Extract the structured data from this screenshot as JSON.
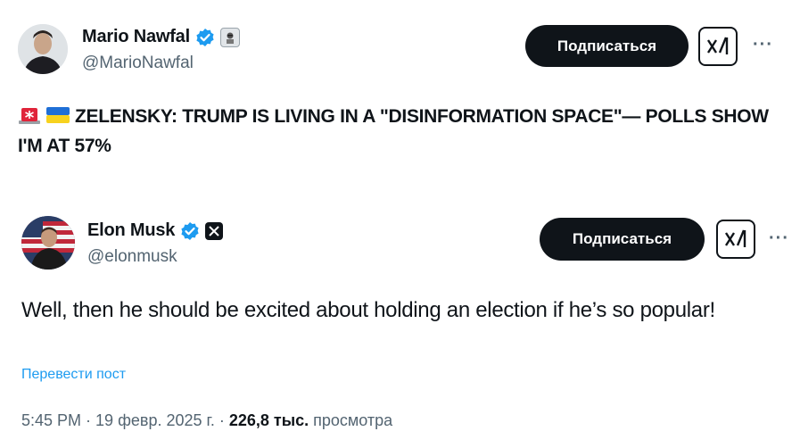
{
  "tweet1": {
    "author_name": "Mario Nawfal",
    "author_handle": "@MarioNawfal",
    "subscribe_label": "Подписаться",
    "text": "ZELENSKY: TRUMP IS LIVING IN A \"DISINFORMATION SPACE\"— POLLS SHOW I'M AT 57%",
    "emojis": [
      "rotating-light-icon",
      "ukraine-flag-icon"
    ]
  },
  "tweet2": {
    "author_name": "Elon Musk",
    "author_handle": "@elonmusk",
    "subscribe_label": "Подписаться",
    "text": "Well, then he should be excited about holding an election if he’s so popular!",
    "translate_label": "Перевести пост",
    "time": "5:45 PM",
    "dot1": "·",
    "date": "19 февр. 2025 г.",
    "dot2": "·",
    "views_count": "226,8 тыс.",
    "views_label": "просмотра"
  },
  "more_label": "···",
  "colors": {
    "accent": "#1d9bf0",
    "button": "#0f1419",
    "muted": "#536471"
  }
}
